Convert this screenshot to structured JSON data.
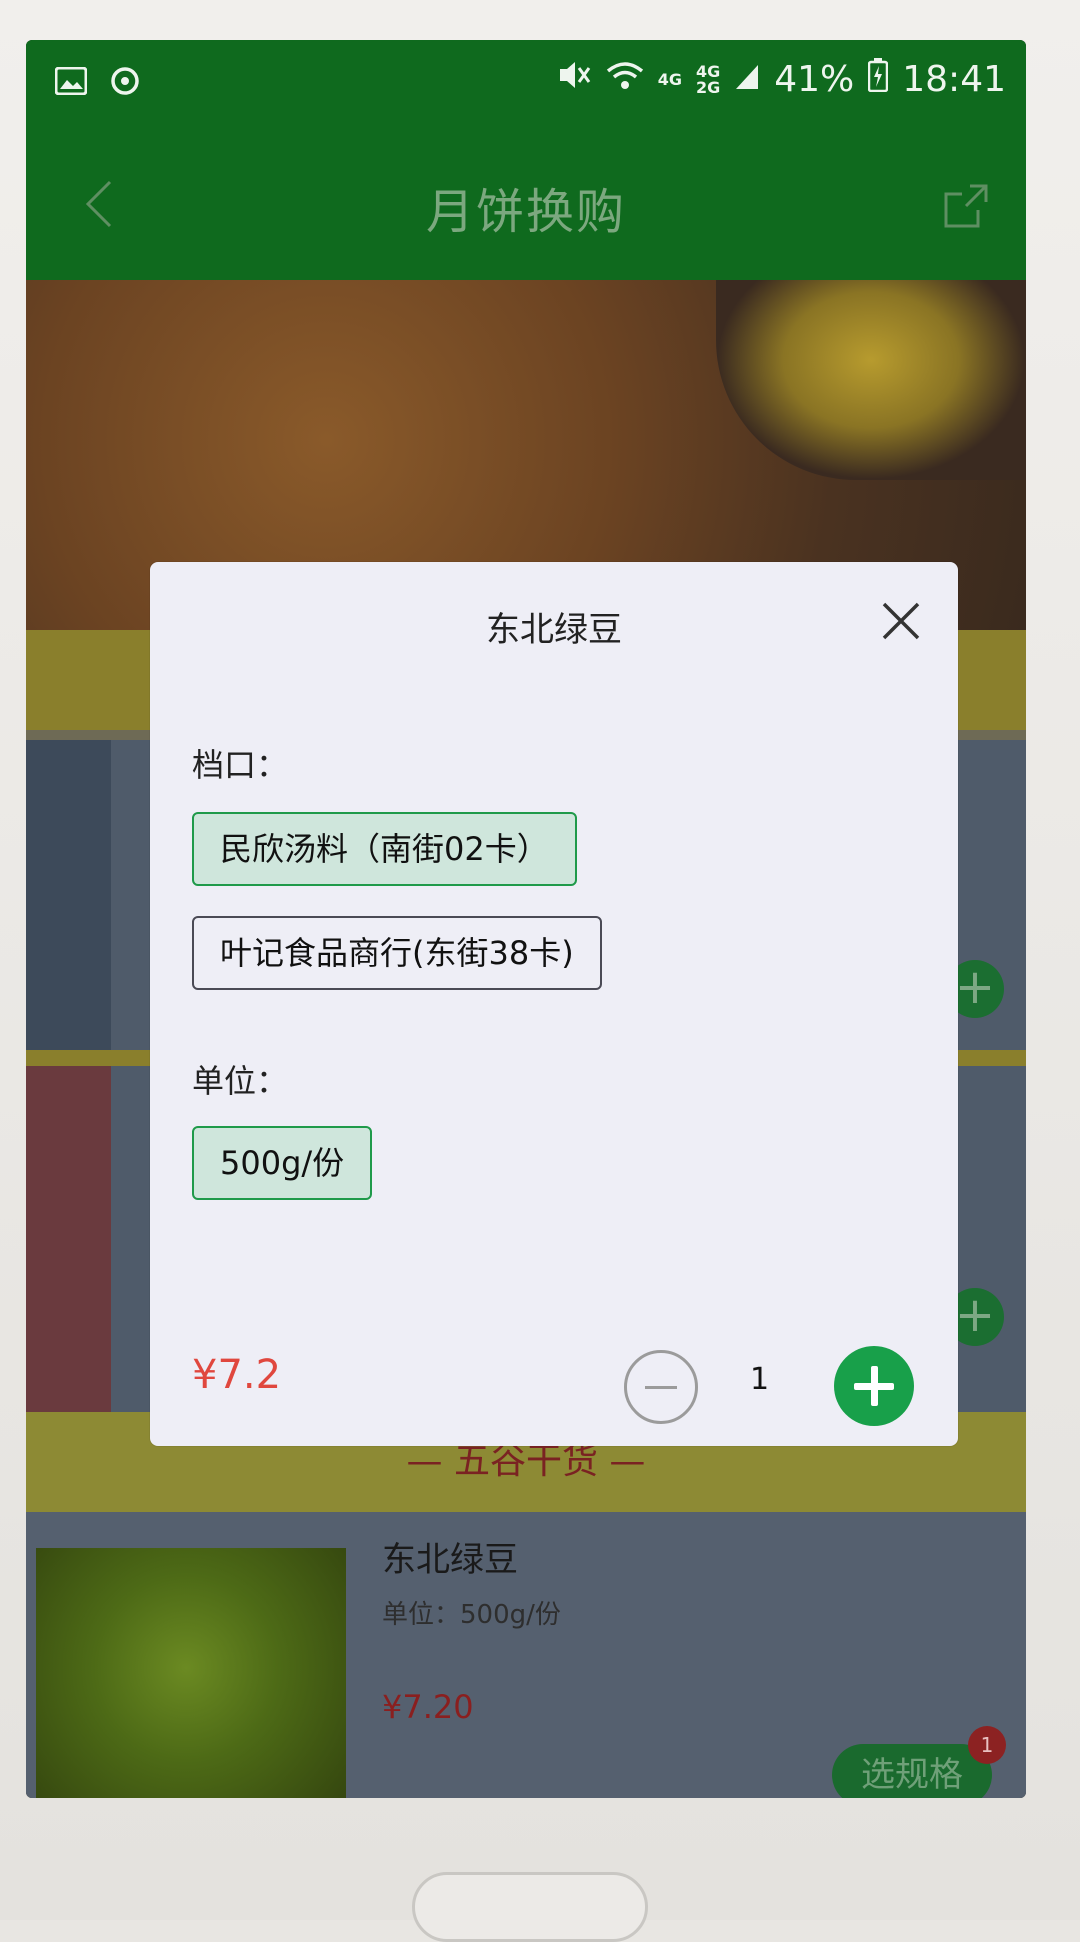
{
  "status_bar": {
    "network_top": "4G",
    "network_stack": "4G",
    "network_stack2": "2G",
    "battery": "41%",
    "time": "18:41"
  },
  "nav": {
    "title": "月饼换购"
  },
  "background": {
    "section_header": "— 五谷干货 —",
    "product": {
      "name": "东北绿豆",
      "unit": "单位：500g/份",
      "price": "¥7.20",
      "spec_button": "选规格",
      "badge": "1"
    }
  },
  "modal": {
    "title": "东北绿豆",
    "stall_label": "档口：",
    "stall_options": [
      {
        "label": "民欣汤料（南街02卡）",
        "selected": true
      },
      {
        "label": "叶记食品商行(东街38卡)",
        "selected": false
      }
    ],
    "unit_label": "单位：",
    "unit_options": [
      {
        "label": "500g/份",
        "selected": true
      }
    ],
    "price": "¥7.2",
    "quantity": "1"
  },
  "colors": {
    "brand_green": "#0f6a1e",
    "accent_green": "#18a04a",
    "price_red": "#e0473e"
  }
}
